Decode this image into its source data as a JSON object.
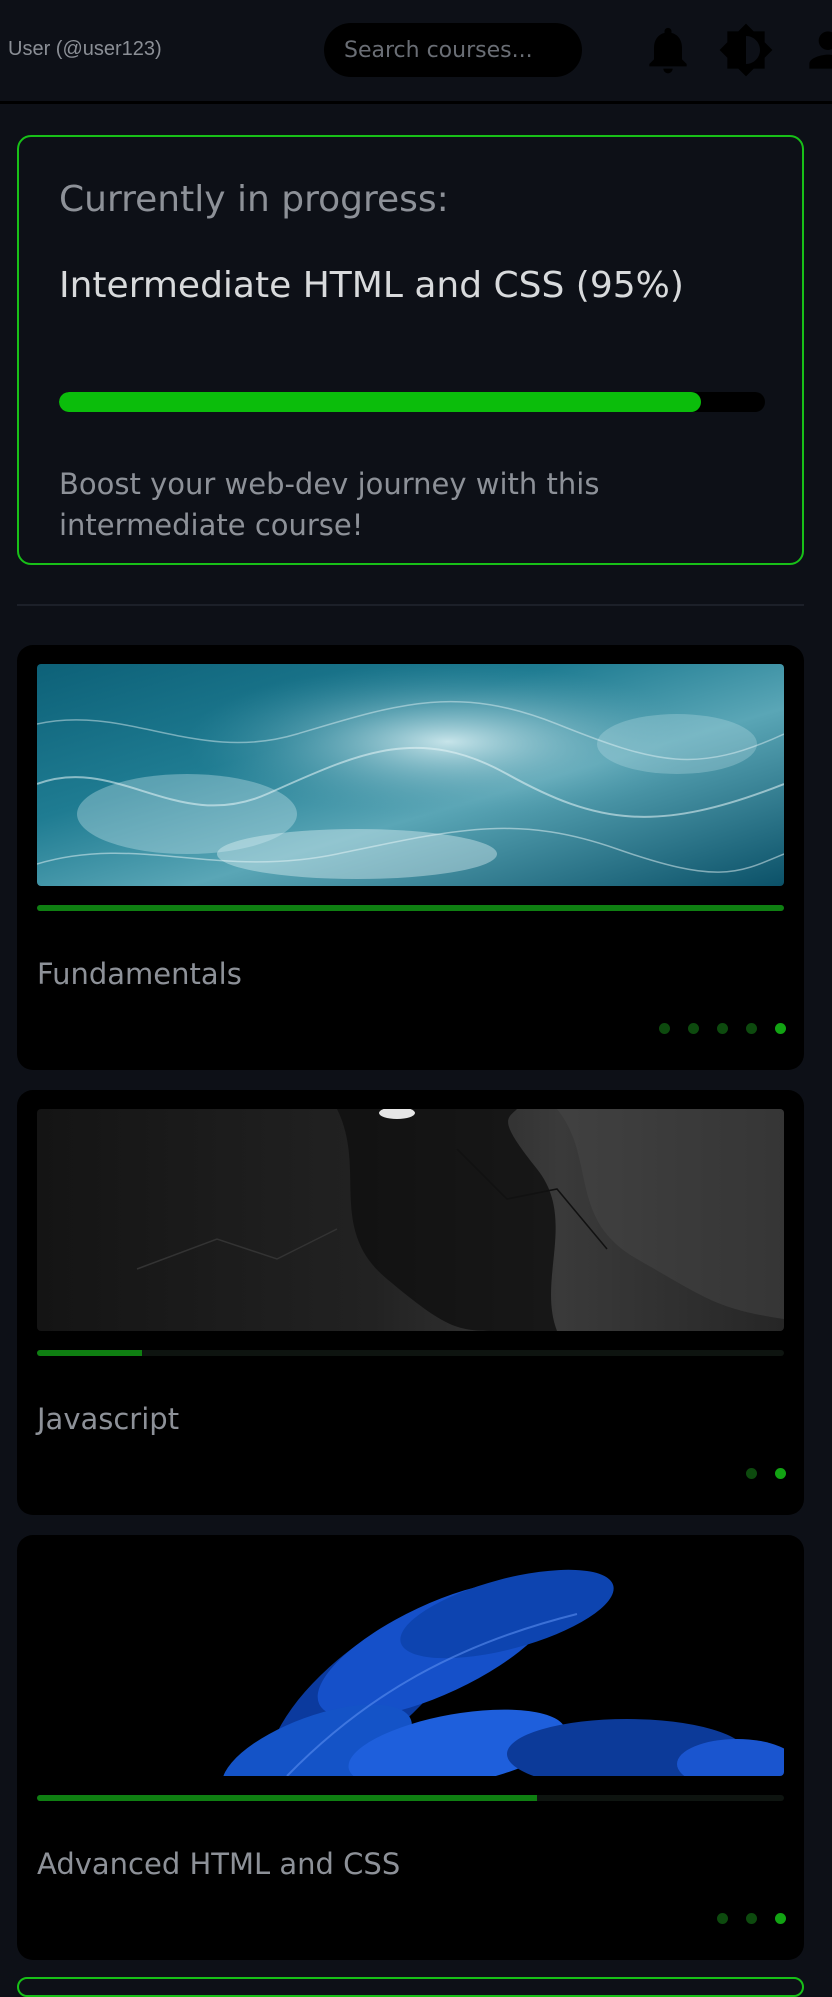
{
  "header": {
    "user_label": "User (@user123)",
    "search_placeholder": "Search courses..."
  },
  "in_progress": {
    "heading": "Currently in progress:",
    "course_title": "Intermediate HTML and CSS (95%)",
    "progress_percent": 91,
    "description": "Boost your web-dev journey with this intermediate course!"
  },
  "courses": [
    {
      "title": "Fundamentals",
      "progress_percent": 100,
      "dots": 5,
      "active_dot": 4
    },
    {
      "title": "Javascript",
      "progress_percent": 14,
      "dots": 2,
      "active_dot": 1
    },
    {
      "title": "Advanced HTML and CSS",
      "progress_percent": 67,
      "dots": 3,
      "active_dot": 2
    }
  ],
  "colors": {
    "accent": "#18c018",
    "background": "#0d1017",
    "card": "#000000"
  }
}
